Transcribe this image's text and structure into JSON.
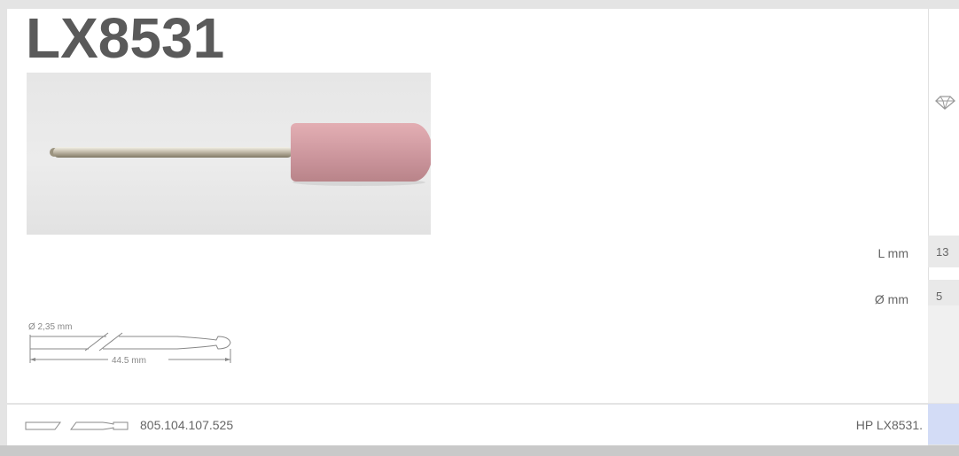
{
  "product": {
    "code": "LX8531"
  },
  "specs": {
    "length_label": "L mm",
    "length_value": "13",
    "diameter_label": "Ø mm",
    "diameter_value": "5"
  },
  "drawing": {
    "shank_diameter": "Ø 2,35 mm",
    "total_length": "44.5 mm"
  },
  "footer": {
    "ref_number": "805.104.107.525",
    "hp_code": "HP LX8531."
  },
  "icons": {
    "gem": "gem-icon",
    "shank": "shank-outline-icon"
  },
  "colors": {
    "stone": "#d3a0a6",
    "title": "#5a5a5a",
    "footer_accent": "#d3dcf6"
  }
}
